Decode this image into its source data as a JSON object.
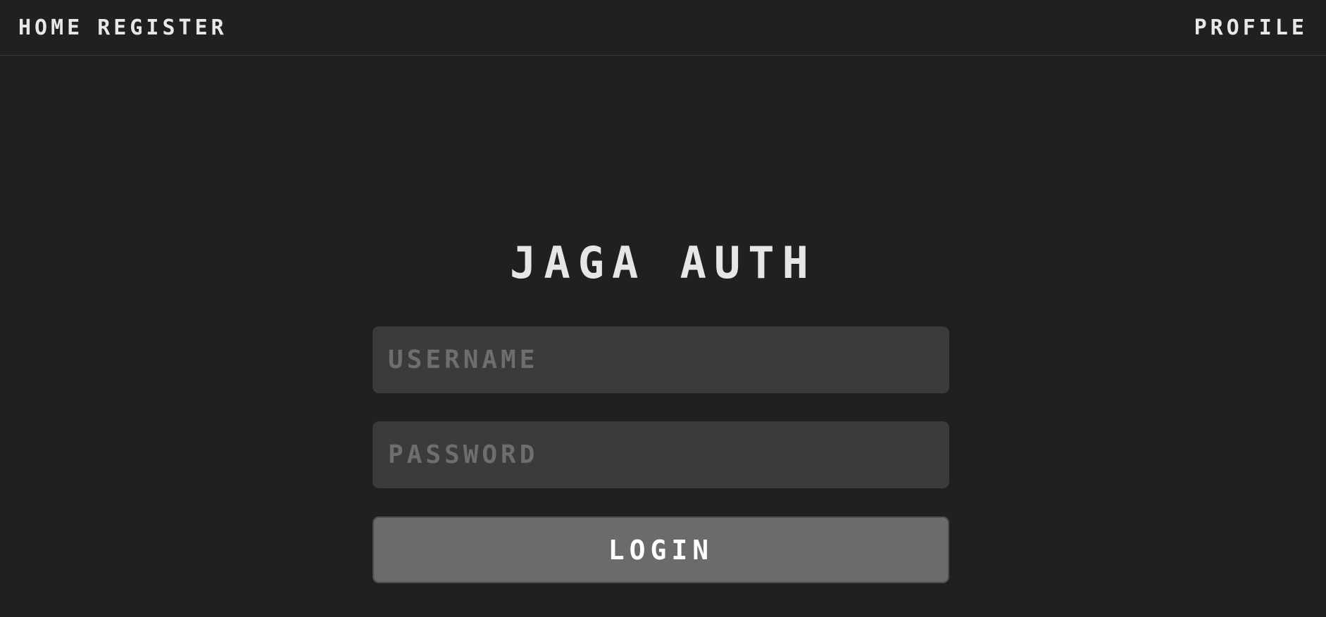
{
  "nav": {
    "home_label": "HOME",
    "register_label": "REGISTER",
    "profile_label": "PROFILE"
  },
  "page": {
    "title": "JAGA AUTH"
  },
  "form": {
    "username": {
      "value": "",
      "placeholder": "USERNAME"
    },
    "password": {
      "value": "",
      "placeholder": "PASSWORD"
    },
    "login_label": "LOGIN"
  },
  "colors": {
    "background": "#1f2022",
    "input_background": "#3b3b3b",
    "placeholder_text": "#6e6e6e",
    "button_background": "#6b6b6b",
    "text": "#e8e8e8"
  }
}
